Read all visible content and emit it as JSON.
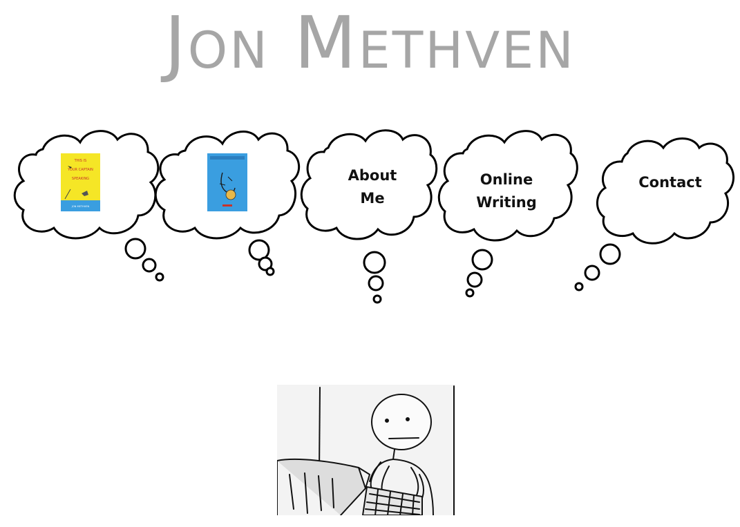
{
  "header": {
    "title": "Jon Methven"
  },
  "nav": {
    "items": [
      {
        "type": "book-cover",
        "cover_text": "THIS IS YOUR CAPTAIN SPEAKING",
        "cover_author": "JON METHVEN"
      },
      {
        "type": "book-cover"
      },
      {
        "type": "link",
        "label": "About Me"
      },
      {
        "type": "link",
        "label": "Online Writing"
      },
      {
        "type": "link",
        "label": "Contact"
      }
    ]
  },
  "colors": {
    "title": "#a6a6a6",
    "outline": "#000000",
    "cover_yellow": "#f5e626",
    "cover_blue": "#3a9ee0"
  },
  "footer_image": {
    "icon": "comic-person-typing-illustration"
  }
}
